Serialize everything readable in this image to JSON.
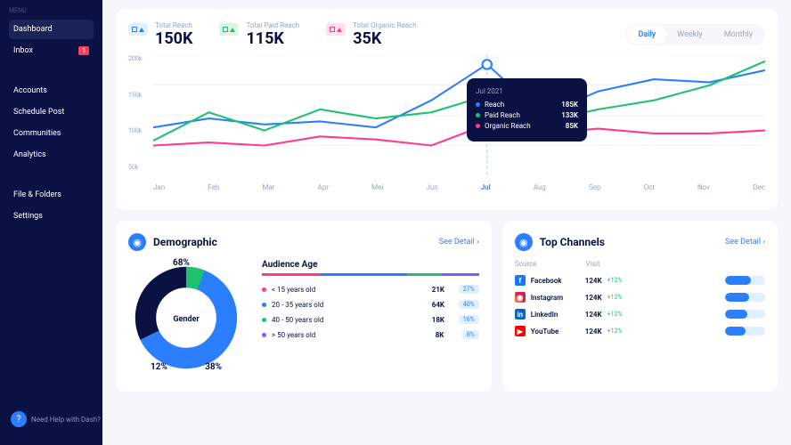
{
  "sidebar": {
    "menuLabel": "MENU",
    "items": [
      {
        "label": "Dashboard",
        "active": true
      },
      {
        "label": "Inbox",
        "badge": "1"
      }
    ],
    "section2Label": "",
    "items2": [
      {
        "label": "Accounts"
      },
      {
        "label": "Schedule Post"
      },
      {
        "label": "Communities"
      },
      {
        "label": "Analytics"
      }
    ],
    "section3Label": "",
    "items3": [
      {
        "label": "File & Folders"
      },
      {
        "label": "Settings"
      }
    ],
    "help": {
      "text": "Need Help with Dash?",
      "icon": "?"
    }
  },
  "stats": [
    {
      "label": "Total Reach",
      "value": "150K",
      "color": "blue"
    },
    {
      "label": "Total Paid Reach",
      "value": "115K",
      "color": "green"
    },
    {
      "label": "Total Organic Reach",
      "value": "35K",
      "color": "pink"
    }
  ],
  "timeTabs": [
    "Daily",
    "Weekly",
    "Monthly"
  ],
  "chart_data": {
    "type": "line",
    "categories": [
      "Jan",
      "Feb",
      "Mar",
      "Apr",
      "Mei",
      "Jun",
      "Jul",
      "Aug",
      "Sep",
      "Oct",
      "Nov",
      "Dec"
    ],
    "series": [
      {
        "name": "Reach",
        "color": "#2b7fff",
        "values": [
          80,
          95,
          85,
          90,
          80,
          125,
          185,
          100,
          140,
          160,
          155,
          175
        ]
      },
      {
        "name": "Paid Reach",
        "color": "#1ec26e",
        "values": [
          58,
          105,
          75,
          110,
          95,
          105,
          133,
          90,
          110,
          125,
          150,
          190
        ]
      },
      {
        "name": "Organic Reach",
        "color": "#ff3b8c",
        "values": [
          50,
          55,
          50,
          65,
          60,
          50,
          85,
          70,
          78,
          70,
          70,
          75
        ]
      }
    ],
    "ylim": [
      0,
      200
    ],
    "yticks": [
      "200k",
      "150k",
      "100k",
      "50k"
    ],
    "highlight": "Jul"
  },
  "tooltip": {
    "title": "Jul 2021",
    "rows": [
      {
        "label": "Reach",
        "value": "185K",
        "color": "#2b7fff"
      },
      {
        "label": "Paid Reach",
        "value": "133K",
        "color": "#1ec26e"
      },
      {
        "label": "Organic Reach",
        "value": "85K",
        "color": "#ff3b8c"
      }
    ]
  },
  "demographic": {
    "title": "Demographic",
    "seeDetail": "See Detail",
    "donut": {
      "center": "Gender",
      "segments": [
        {
          "pct": 68,
          "color": "#2b7fff"
        },
        {
          "pct": 38,
          "color": "#0a1244"
        },
        {
          "pct": 12,
          "color": "#1ec26e"
        }
      ]
    },
    "audience": {
      "title": "Audience Age",
      "rows": [
        {
          "label": "< 15 years old",
          "value": "21K",
          "pct": "27%",
          "color": "#ff3b8c"
        },
        {
          "label": "20 - 35 years old",
          "value": "64K",
          "pct": "40%",
          "color": "#2b7fff"
        },
        {
          "label": "40 - 50 years old",
          "value": "18K",
          "pct": "16%",
          "color": "#1ec26e"
        },
        {
          "label": "> 50 years old",
          "value": "8K",
          "pct": "8%",
          "color": "#7b5cff"
        }
      ]
    }
  },
  "channels": {
    "title": "Top Channels",
    "seeDetail": "See Detail",
    "head": {
      "source": "Source",
      "visit": "Visit"
    },
    "rows": [
      {
        "name": "Facebook",
        "value": "124K",
        "pct": "+12%",
        "bg": "#1877f2",
        "letter": "f",
        "fill": 65
      },
      {
        "name": "Instagram",
        "value": "124K",
        "pct": "+12%",
        "bg": "linear-gradient(45deg,#f09433,#e6683c,#dc2743,#cc2366,#bc1888)",
        "letter": "◉",
        "fill": 60
      },
      {
        "name": "LinkedIn",
        "value": "124K",
        "pct": "+12%",
        "bg": "#0a66c2",
        "letter": "in",
        "fill": 55
      },
      {
        "name": "YouTube",
        "value": "124K",
        "pct": "+12%",
        "bg": "#ff0000",
        "letter": "▶",
        "fill": 50
      }
    ]
  }
}
